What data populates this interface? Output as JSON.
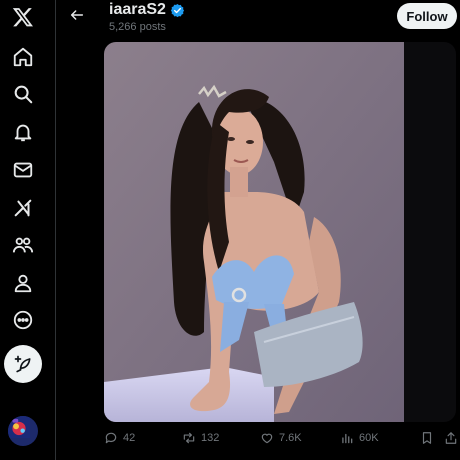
{
  "nav": {
    "items": [
      {
        "icon": "x-logo-icon"
      },
      {
        "icon": "home-icon"
      },
      {
        "icon": "search-icon"
      },
      {
        "icon": "bell-icon"
      },
      {
        "icon": "mail-icon"
      },
      {
        "icon": "grok-icon"
      },
      {
        "icon": "communities-icon"
      },
      {
        "icon": "profile-icon"
      },
      {
        "icon": "more-icon"
      }
    ],
    "compose_icon": "feather-plus-icon"
  },
  "header": {
    "name": "iaaraS2",
    "posts": "5,266 posts",
    "follow_label": "Follow"
  },
  "actions": {
    "replies": "42",
    "reposts": "132",
    "likes": "7.6K",
    "views": "60K"
  },
  "colors": {
    "background": "#000000",
    "accent": "#1d9bf0",
    "text": "#e7e9ea",
    "muted": "#71767b",
    "button_bg": "#eff3f4"
  }
}
